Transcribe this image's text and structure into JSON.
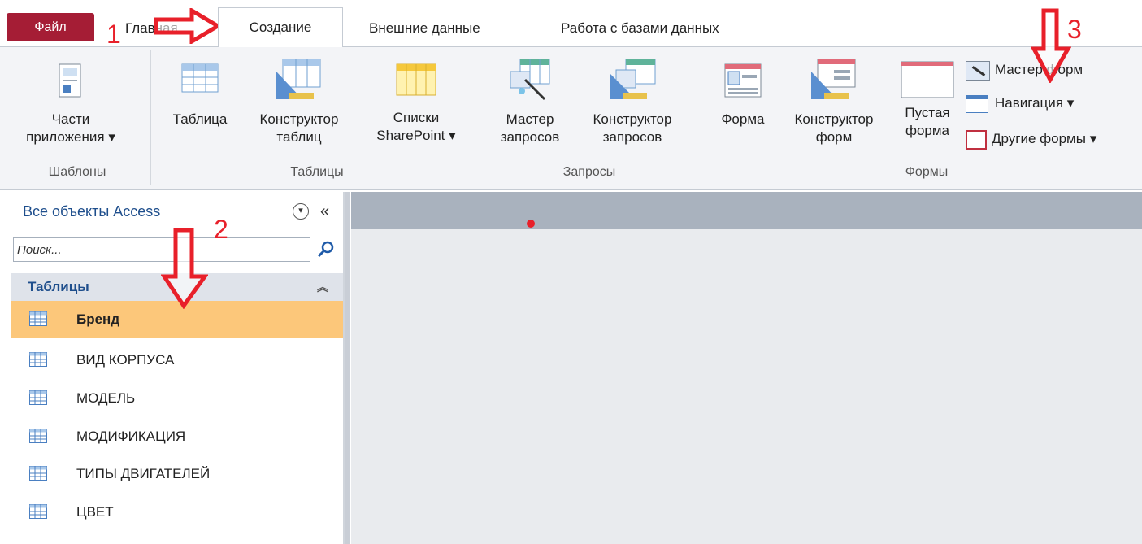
{
  "tabs": {
    "file": "Файл",
    "home": "Главная",
    "create": "Создание",
    "external": "Внешние данные",
    "database": "Работа с базами данных"
  },
  "ribbon": {
    "templates": {
      "app_parts": "Части",
      "app_parts2": "приложения",
      "label": "Шаблоны"
    },
    "tables": {
      "table": "Таблица",
      "designer": "Конструктор",
      "designer2": "таблиц",
      "sharepoint": "Списки",
      "sharepoint2": "SharePoint",
      "label": "Таблицы"
    },
    "queries": {
      "wizard": "Мастер",
      "wizard2": "запросов",
      "designer": "Конструктор",
      "designer2": "запросов",
      "label": "Запросы"
    },
    "forms": {
      "form": "Форма",
      "designer": "Конструктор",
      "designer2": "форм",
      "blank": "Пустая",
      "blank2": "форма",
      "form_wizard": "Мастер форм",
      "navigation": "Навигация",
      "other_forms": "Другие формы",
      "label": "Формы"
    }
  },
  "nav": {
    "header": "Все объекты Access",
    "collapse": "«",
    "search_placeholder": "Поиск...",
    "section": "Таблицы",
    "items": [
      "Бренд",
      "ВИД КОРПУСА",
      "МОДЕЛЬ",
      "МОДИФИКАЦИЯ",
      "ТИПЫ ДВИГАТЕЛЕЙ",
      "ЦВЕТ"
    ]
  },
  "annotations": {
    "n1": "1",
    "n2": "2",
    "n3": "3"
  },
  "colors": {
    "file_tab": "#a51d35",
    "selected_row": "#fcc77a",
    "arrow": "#e8202a"
  }
}
